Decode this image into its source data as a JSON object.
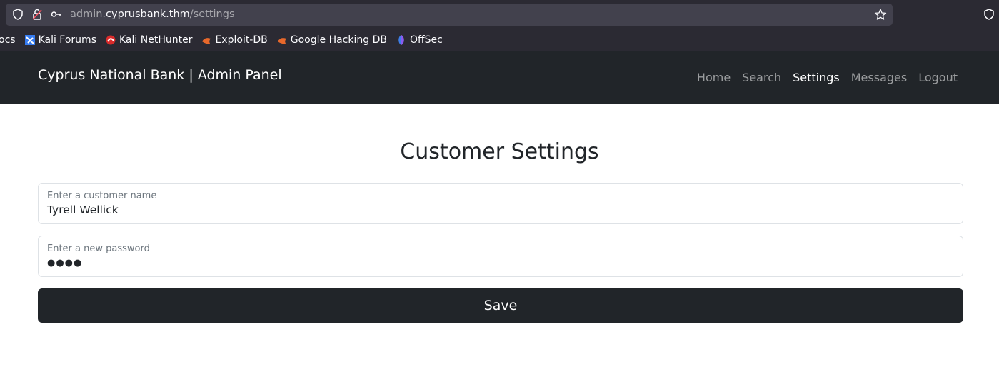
{
  "browser": {
    "url_prefix": "admin.",
    "url_domain": "cyprusbank.thm",
    "url_path": "/settings",
    "bookmarks": [
      {
        "label": "ocs",
        "icon": "none"
      },
      {
        "label": "Kali Forums",
        "icon": "kali-forums-icon"
      },
      {
        "label": "Kali NetHunter",
        "icon": "kali-nethunter-icon"
      },
      {
        "label": "Exploit-DB",
        "icon": "exploit-db-icon"
      },
      {
        "label": "Google Hacking DB",
        "icon": "ghdb-icon"
      },
      {
        "label": "OffSec",
        "icon": "offsec-icon"
      }
    ]
  },
  "navbar": {
    "brand": "Cyprus National Bank | Admin Panel",
    "links": [
      {
        "label": "Home",
        "active": false
      },
      {
        "label": "Search",
        "active": false
      },
      {
        "label": "Settings",
        "active": true
      },
      {
        "label": "Messages",
        "active": false
      },
      {
        "label": "Logout",
        "active": false
      }
    ]
  },
  "main": {
    "title": "Customer Settings",
    "customer_name": {
      "label": "Enter a customer name",
      "value": "Tyrell Wellick"
    },
    "password": {
      "label": "Enter a new password",
      "value": "●●●●"
    },
    "save_label": "Save"
  },
  "colors": {
    "navbar_bg": "#212529",
    "browser_bg": "#2b2a33",
    "urlbar_bg": "#42414d",
    "button_bg": "#212529"
  }
}
